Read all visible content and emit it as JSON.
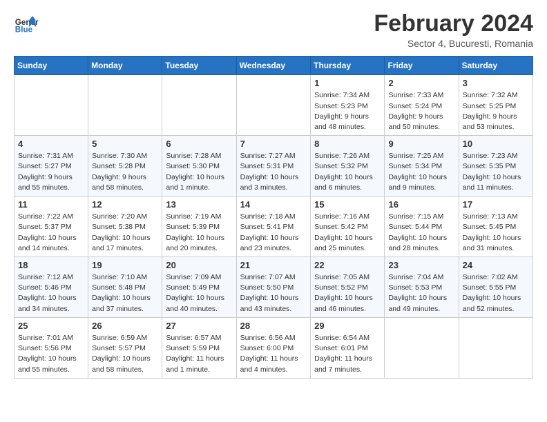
{
  "logo": {
    "text_general": "General",
    "text_blue": "Blue"
  },
  "title": "February 2024",
  "subtitle": "Sector 4, Bucuresti, Romania",
  "days_of_week": [
    "Sunday",
    "Monday",
    "Tuesday",
    "Wednesday",
    "Thursday",
    "Friday",
    "Saturday"
  ],
  "weeks": [
    [
      {
        "date": "",
        "info": ""
      },
      {
        "date": "",
        "info": ""
      },
      {
        "date": "",
        "info": ""
      },
      {
        "date": "",
        "info": ""
      },
      {
        "date": "1",
        "info": "Sunrise: 7:34 AM\nSunset: 5:23 PM\nDaylight: 9 hours\nand 48 minutes."
      },
      {
        "date": "2",
        "info": "Sunrise: 7:33 AM\nSunset: 5:24 PM\nDaylight: 9 hours\nand 50 minutes."
      },
      {
        "date": "3",
        "info": "Sunrise: 7:32 AM\nSunset: 5:25 PM\nDaylight: 9 hours\nand 53 minutes."
      }
    ],
    [
      {
        "date": "4",
        "info": "Sunrise: 7:31 AM\nSunset: 5:27 PM\nDaylight: 9 hours\nand 55 minutes."
      },
      {
        "date": "5",
        "info": "Sunrise: 7:30 AM\nSunset: 5:28 PM\nDaylight: 9 hours\nand 58 minutes."
      },
      {
        "date": "6",
        "info": "Sunrise: 7:28 AM\nSunset: 5:30 PM\nDaylight: 10 hours\nand 1 minute."
      },
      {
        "date": "7",
        "info": "Sunrise: 7:27 AM\nSunset: 5:31 PM\nDaylight: 10 hours\nand 3 minutes."
      },
      {
        "date": "8",
        "info": "Sunrise: 7:26 AM\nSunset: 5:32 PM\nDaylight: 10 hours\nand 6 minutes."
      },
      {
        "date": "9",
        "info": "Sunrise: 7:25 AM\nSunset: 5:34 PM\nDaylight: 10 hours\nand 9 minutes."
      },
      {
        "date": "10",
        "info": "Sunrise: 7:23 AM\nSunset: 5:35 PM\nDaylight: 10 hours\nand 11 minutes."
      }
    ],
    [
      {
        "date": "11",
        "info": "Sunrise: 7:22 AM\nSunset: 5:37 PM\nDaylight: 10 hours\nand 14 minutes."
      },
      {
        "date": "12",
        "info": "Sunrise: 7:20 AM\nSunset: 5:38 PM\nDaylight: 10 hours\nand 17 minutes."
      },
      {
        "date": "13",
        "info": "Sunrise: 7:19 AM\nSunset: 5:39 PM\nDaylight: 10 hours\nand 20 minutes."
      },
      {
        "date": "14",
        "info": "Sunrise: 7:18 AM\nSunset: 5:41 PM\nDaylight: 10 hours\nand 23 minutes."
      },
      {
        "date": "15",
        "info": "Sunrise: 7:16 AM\nSunset: 5:42 PM\nDaylight: 10 hours\nand 25 minutes."
      },
      {
        "date": "16",
        "info": "Sunrise: 7:15 AM\nSunset: 5:44 PM\nDaylight: 10 hours\nand 28 minutes."
      },
      {
        "date": "17",
        "info": "Sunrise: 7:13 AM\nSunset: 5:45 PM\nDaylight: 10 hours\nand 31 minutes."
      }
    ],
    [
      {
        "date": "18",
        "info": "Sunrise: 7:12 AM\nSunset: 5:46 PM\nDaylight: 10 hours\nand 34 minutes."
      },
      {
        "date": "19",
        "info": "Sunrise: 7:10 AM\nSunset: 5:48 PM\nDaylight: 10 hours\nand 37 minutes."
      },
      {
        "date": "20",
        "info": "Sunrise: 7:09 AM\nSunset: 5:49 PM\nDaylight: 10 hours\nand 40 minutes."
      },
      {
        "date": "21",
        "info": "Sunrise: 7:07 AM\nSunset: 5:50 PM\nDaylight: 10 hours\nand 43 minutes."
      },
      {
        "date": "22",
        "info": "Sunrise: 7:05 AM\nSunset: 5:52 PM\nDaylight: 10 hours\nand 46 minutes."
      },
      {
        "date": "23",
        "info": "Sunrise: 7:04 AM\nSunset: 5:53 PM\nDaylight: 10 hours\nand 49 minutes."
      },
      {
        "date": "24",
        "info": "Sunrise: 7:02 AM\nSunset: 5:55 PM\nDaylight: 10 hours\nand 52 minutes."
      }
    ],
    [
      {
        "date": "25",
        "info": "Sunrise: 7:01 AM\nSunset: 5:56 PM\nDaylight: 10 hours\nand 55 minutes."
      },
      {
        "date": "26",
        "info": "Sunrise: 6:59 AM\nSunset: 5:57 PM\nDaylight: 10 hours\nand 58 minutes."
      },
      {
        "date": "27",
        "info": "Sunrise: 6:57 AM\nSunset: 5:59 PM\nDaylight: 11 hours\nand 1 minute."
      },
      {
        "date": "28",
        "info": "Sunrise: 6:56 AM\nSunset: 6:00 PM\nDaylight: 11 hours\nand 4 minutes."
      },
      {
        "date": "29",
        "info": "Sunrise: 6:54 AM\nSunset: 6:01 PM\nDaylight: 11 hours\nand 7 minutes."
      },
      {
        "date": "",
        "info": ""
      },
      {
        "date": "",
        "info": ""
      }
    ]
  ]
}
